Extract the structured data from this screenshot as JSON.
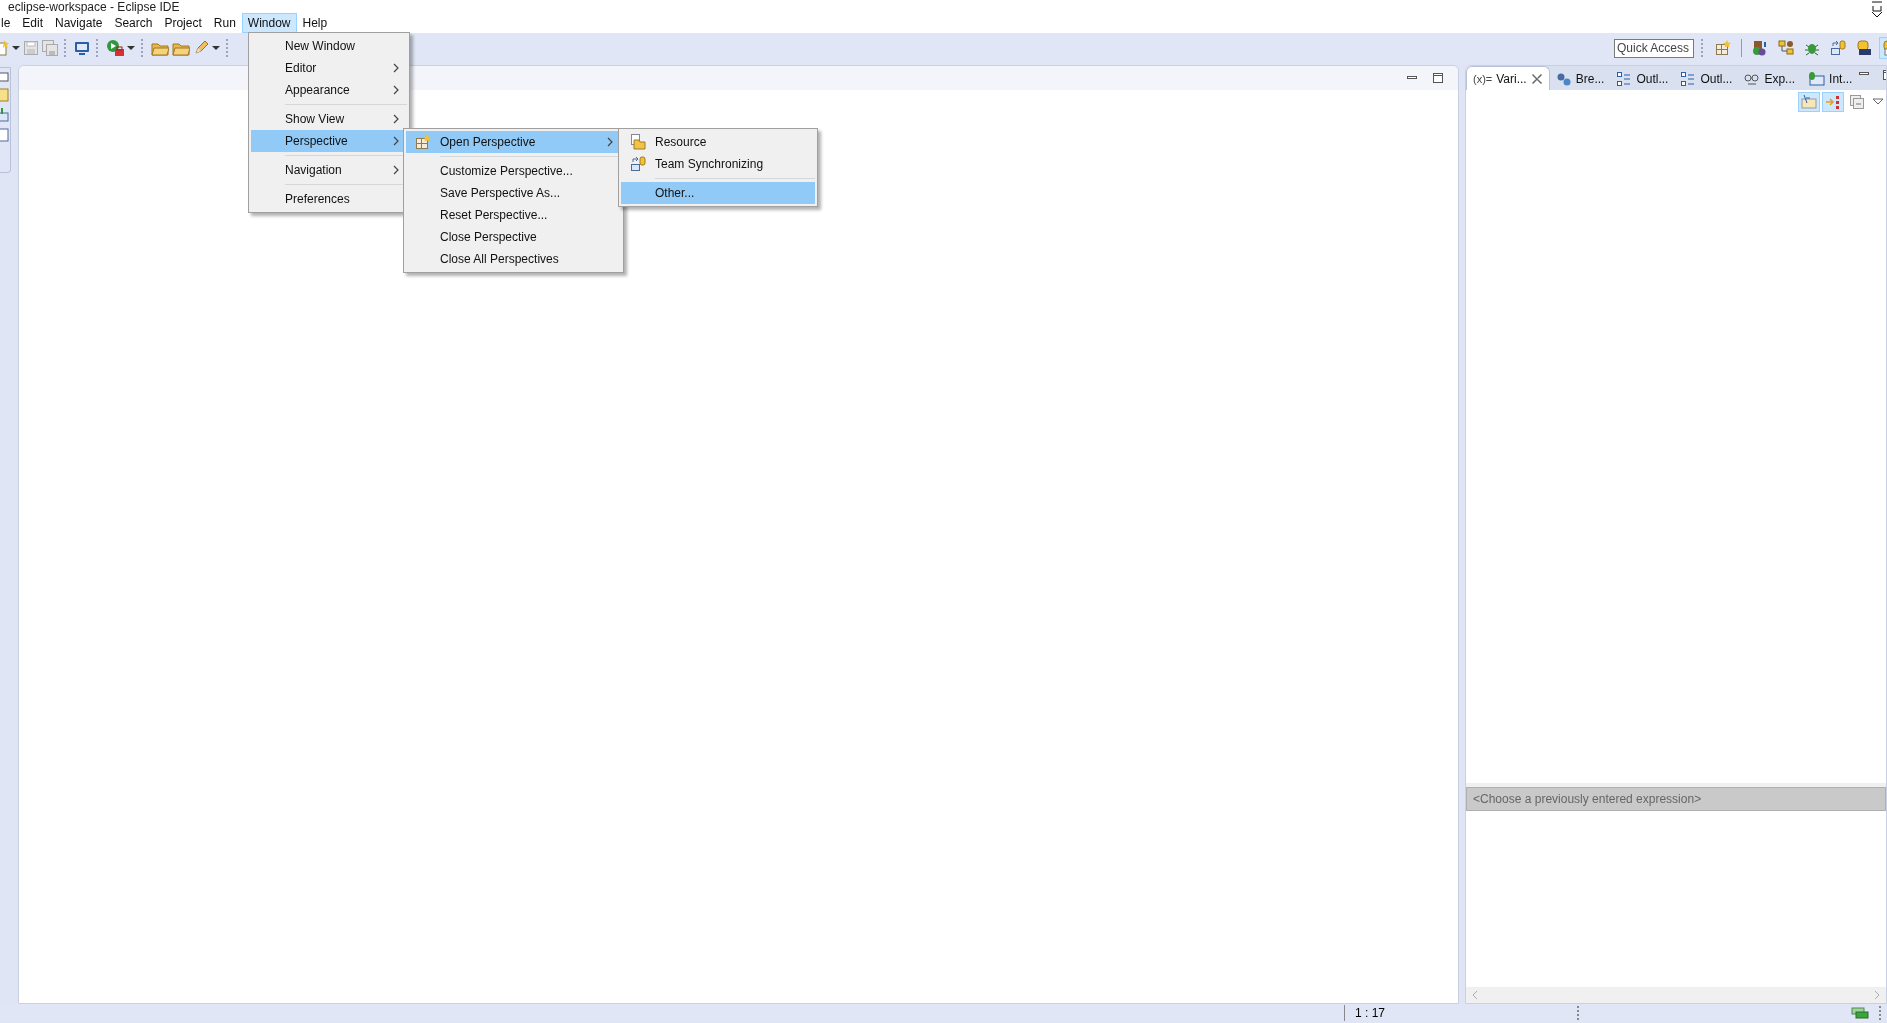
{
  "window": {
    "title": "eclipse-workspace - Eclipse IDE"
  },
  "menubar": [
    {
      "label": "le",
      "selected": false
    },
    {
      "label": "Edit",
      "selected": false
    },
    {
      "label": "Navigate",
      "selected": false
    },
    {
      "label": "Search",
      "selected": false
    },
    {
      "label": "Project",
      "selected": false
    },
    {
      "label": "Run",
      "selected": false
    },
    {
      "label": "Window",
      "selected": true
    },
    {
      "label": "Help",
      "selected": false
    }
  ],
  "quick_access": {
    "placeholder": "Quick Access"
  },
  "perspective_buttons": [
    {
      "selected": false
    },
    {
      "selected": false
    },
    {
      "selected": false
    },
    {
      "selected": false
    },
    {
      "selected": false
    },
    {
      "selected": true
    }
  ],
  "menus": [
    {
      "items": [
        {
          "kind": "item",
          "label": "New Window",
          "submenu": false,
          "selected": false
        },
        {
          "kind": "item",
          "label": "Editor",
          "submenu": true,
          "selected": false
        },
        {
          "kind": "item",
          "label": "Appearance",
          "submenu": true,
          "selected": false
        },
        {
          "kind": "separator"
        },
        {
          "kind": "item",
          "label": "Show View",
          "submenu": true,
          "selected": false
        },
        {
          "kind": "item",
          "label": "Perspective",
          "submenu": true,
          "selected": true
        },
        {
          "kind": "separator"
        },
        {
          "kind": "item",
          "label": "Navigation",
          "submenu": true,
          "selected": false
        },
        {
          "kind": "separator"
        },
        {
          "kind": "item",
          "label": "Preferences",
          "submenu": false,
          "selected": false
        }
      ]
    },
    {
      "items": [
        {
          "kind": "item",
          "label": "Open Perspective",
          "submenu": true,
          "selected": true
        },
        {
          "kind": "separator"
        },
        {
          "kind": "item",
          "label": "Customize Perspective...",
          "submenu": false,
          "selected": false
        },
        {
          "kind": "item",
          "label": "Save Perspective As...",
          "submenu": false,
          "selected": false
        },
        {
          "kind": "item",
          "label": "Reset Perspective...",
          "submenu": false,
          "selected": false
        },
        {
          "kind": "item",
          "label": "Close Perspective",
          "submenu": false,
          "selected": false
        },
        {
          "kind": "item",
          "label": "Close All Perspectives",
          "submenu": false,
          "selected": false
        }
      ]
    },
    {
      "items": [
        {
          "kind": "item",
          "label": "Resource",
          "submenu": false,
          "selected": false
        },
        {
          "kind": "item",
          "label": "Team Synchronizing",
          "submenu": false,
          "selected": false
        },
        {
          "kind": "separator"
        },
        {
          "kind": "item",
          "label": "Other...",
          "submenu": false,
          "selected": true
        }
      ]
    }
  ],
  "view_panel": {
    "tabs": [
      {
        "icon_text": "(x)=",
        "label": "Vari...",
        "selected": true
      },
      {
        "label": "Bre...",
        "selected": false
      },
      {
        "label": "Outl...",
        "selected": false
      },
      {
        "label": "Outl...",
        "selected": false
      },
      {
        "label": "Exp...",
        "selected": false
      },
      {
        "label": "Int...",
        "selected": false
      }
    ],
    "view_buttons": [
      {
        "on": true
      },
      {
        "on": true
      },
      {
        "on": false
      }
    ],
    "expression_field": {
      "placeholder": "<Choose a previously entered expression>"
    }
  },
  "status_bar": {
    "position": "1 : 17"
  }
}
